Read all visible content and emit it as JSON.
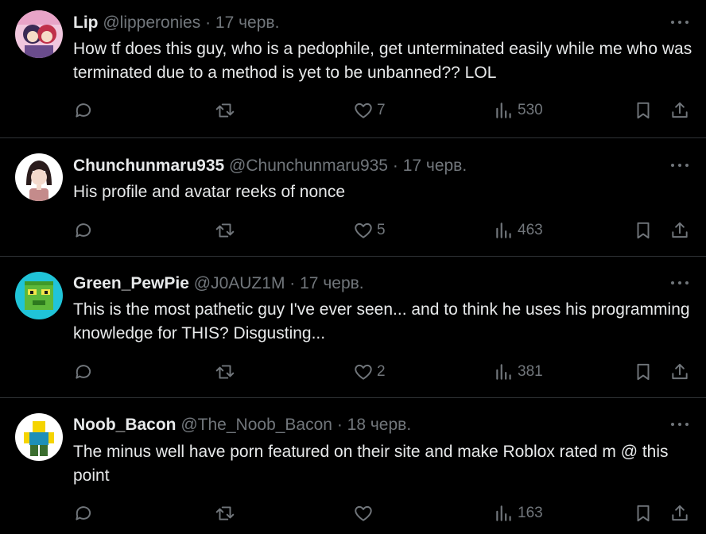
{
  "posts": [
    {
      "name": "Lip",
      "handle": "@lipperonies",
      "date": "17 черв.",
      "text": "How tf does this guy, who is a pedophile, get unterminated easily while me who was terminated due to a method is yet to be unbanned?? LOL",
      "likes": "7",
      "views": "530"
    },
    {
      "name": "Chunchunmaru935",
      "handle": "@Chunchunmaru935",
      "date": "17 черв.",
      "text": "His profile and avatar reeks of nonce",
      "likes": "5",
      "views": "463"
    },
    {
      "name": "Green_PewPie",
      "handle": "@J0AUZ1M",
      "date": "17 черв.",
      "text": "This is the most pathetic guy I've ever seen... and to think he uses his programming knowledge for THIS? Disgusting...",
      "likes": "2",
      "views": "381"
    },
    {
      "name": "Noob_Bacon",
      "handle": "@The_Noob_Bacon",
      "date": "18 черв.",
      "text": "The minus well have porn featured on their site and make Roblox rated m @ this point",
      "likes": "",
      "views": "163"
    }
  ],
  "separator": "·",
  "icons": {
    "reply": "reply-icon",
    "repost": "repost-icon",
    "like": "heart-icon",
    "views": "views-icon",
    "bookmark": "bookmark-icon",
    "share": "share-icon",
    "more": "more-icon"
  },
  "colors": {
    "background": "#000000",
    "text": "#e7e9ea",
    "muted": "#71767b",
    "divider": "#2f3336"
  }
}
